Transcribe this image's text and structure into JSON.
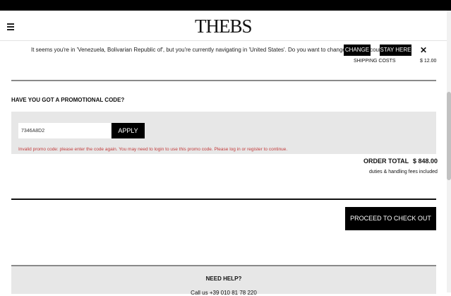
{
  "header": {
    "logo_text": "THEBS",
    "menu_icon": "hamburger-icon"
  },
  "notice": {
    "message": "It seems you're in 'Venezuela, Bolivarian Republic of', but you're currently navigating in 'United States'. Do you want to change shipping country?",
    "change_label": "CHANGE",
    "stay_label": "STAY HERE",
    "close_icon": "close-icon"
  },
  "shipping": {
    "label": "SHIPPING COSTS",
    "value": "$ 12.00"
  },
  "promo": {
    "heading": "HAVE YOU GOT A PROMOTIONAL CODE?",
    "code_value": "7346A8D2",
    "apply_label": "APPLY",
    "error": "Invalid promo code: please enter the code again. You may need to login to use this promo code. Please log in or register to continue."
  },
  "order": {
    "total_label": "ORDER TOTAL",
    "total_value": "$ 848.00",
    "duties_note": "duties & handling fees included"
  },
  "checkout": {
    "label": "PROCEED TO CHECK OUT"
  },
  "help": {
    "title": "NEED HELP?",
    "call": "Call us +39 010 81 78 220"
  },
  "colors": {
    "error": "#c23b3b",
    "panel": "#e7e7e7",
    "button": "#000000"
  }
}
